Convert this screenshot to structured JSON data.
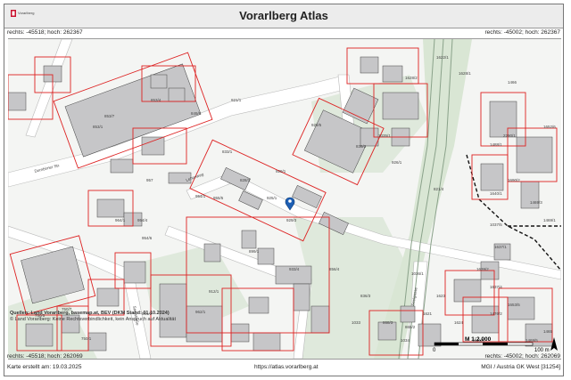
{
  "title": "Vorarlberg Atlas",
  "logo_text": "Vorarlberg",
  "coords": {
    "top_left": "rechts: -45518; hoch: 262367",
    "top_right": "rechts: -45002; hoch: 262367",
    "bottom_left": "rechts: -45518; hoch: 262069",
    "bottom_right": "rechts: -45002; hoch: 262069"
  },
  "source": {
    "line1": "Quellen: Land Vorarlberg, basemap.at, BEV (DKM Stand: 01.10.2024)",
    "line2": "© Land Vorarlberg: Keine Rechtsverbindlichkeit, kein Anspruch auf Aktualität"
  },
  "scale": {
    "ratio": "M 1:2.000",
    "start": "0",
    "end": "100 m"
  },
  "footer": {
    "created": "Karte erstellt am: 19.03.2025",
    "url": "https://atlas.vorarlberg.at",
    "projection": "MGI / Austria GK West [31254]"
  },
  "marker": {
    "parcel": "929/3"
  },
  "parcel_labels": [
    "853/7",
    "853/1",
    "853/4",
    "849/9",
    "921/1",
    "929/5",
    "929/1",
    "828/3",
    "821/4",
    "929/3",
    "899/1",
    "925/1",
    "957",
    "833/1",
    "954/1",
    "954/4",
    "954/6",
    "962/1",
    "856/4",
    "912/1",
    "955/5",
    "933/4",
    "964/1",
    "861/2",
    "750/5",
    "750/7",
    "750/1",
    "1622/1",
    "1035/1",
    "1033",
    "1034",
    "1036/1",
    "1037/5",
    "1637/4",
    "1653/5",
    "1637/1",
    "1639/2",
    "1640/1",
    "2290/1",
    "1466",
    "868/3",
    "865/2",
    "1621",
    "1623",
    "1624",
    "1488/1",
    "1652/6",
    "1690/2",
    "1469/3",
    "1469/1",
    "1476/2",
    "1469/5",
    "1045/5",
    "1465",
    "1628/1",
    "1628/2",
    "836/2",
    "836/3",
    "926/1"
  ],
  "street_labels": [
    "Dornbirner Str.",
    "Stegstraße",
    "Lehenweg",
    "Seelgasse"
  ]
}
